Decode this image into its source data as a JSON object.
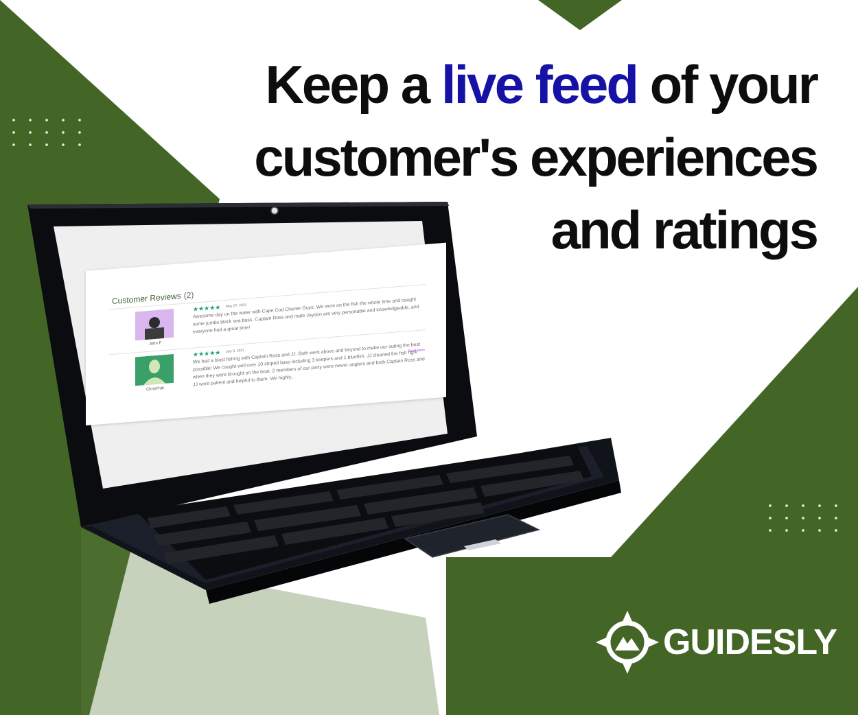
{
  "headline": {
    "line1_pre": "Keep a ",
    "line1_accent": "live feed",
    "line1_post": " of your",
    "line2": "customer's experiences",
    "line3": "and ratings"
  },
  "reviews": {
    "title": "Customer Reviews",
    "count": "(2)",
    "items": [
      {
        "stars": "★★★★★",
        "date": "May 27, 2021",
        "text": "Awesome day on the water with Cape Cod Charter Guys. We were on the fish the whole time and caught some jumbo black sea bass. Captain Ross and mate Jaydon are very personable and knowledgeable, and everyone had a great time!",
        "author": "John F"
      },
      {
        "stars": "★★★★★",
        "date": "July 9, 2021",
        "text": "We had a blast fishing with Captain Ross and JJ. Both went above and beyond to make our outing the best possible! We caught well over 10 striped bass including 3 keepers and 1 bluefish. JJ cleaned the fish right when they were brought on the boat. 2 members of our party were newer anglers and both Captain Ross and JJ were patient and helpful to them. We highly...",
        "author": "ChrisPrak",
        "read_more": "Read More"
      }
    ]
  },
  "brand": {
    "name": "GUIDESLY"
  },
  "colors": {
    "green": "#436627",
    "accent_blue": "#1712a6",
    "star_green": "#19a26b",
    "text_black": "#0d0d0d"
  },
  "icons": [
    "compass-logo-icon",
    "avatar-icon"
  ]
}
